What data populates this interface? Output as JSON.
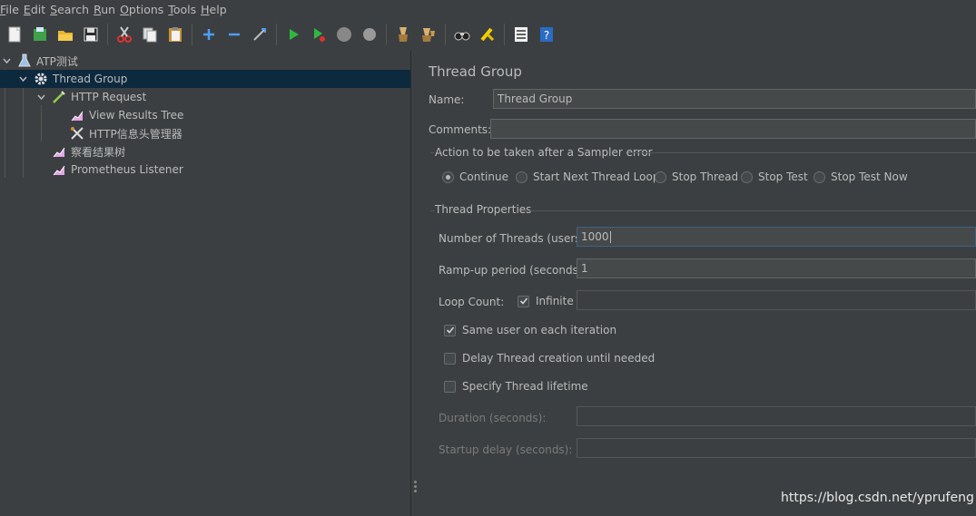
{
  "menu": [
    {
      "mnemonic": "F",
      "rest": "ile"
    },
    {
      "mnemonic": "E",
      "rest": "dit"
    },
    {
      "mnemonic": "S",
      "rest": "earch"
    },
    {
      "mnemonic": "R",
      "rest": "un"
    },
    {
      "mnemonic": "O",
      "rest": "ptions"
    },
    {
      "mnemonic": "T",
      "rest": "ools"
    },
    {
      "mnemonic": "H",
      "rest": "elp"
    }
  ],
  "toolbar_icons": [
    "new-icon",
    "templates-icon",
    "open-icon",
    "save-icon",
    "cut-icon",
    "copy-icon",
    "paste-icon",
    "expand-icon",
    "collapse-icon",
    "toggle-icon",
    "start-icon",
    "start-no-pause-icon",
    "stop-icon",
    "shutdown-icon",
    "clear-icon",
    "clear-all-icon",
    "search-icon",
    "reset-search-icon",
    "function-helper-icon",
    "help-icon"
  ],
  "tree": {
    "test_plan": "ATP测试",
    "thread_group": "Thread Group",
    "http_request": "HTTP Request",
    "view_results_tree": "View Results Tree",
    "header_manager": "HTTP信息头管理器",
    "results_tree_cn": "察看结果树",
    "prometheus": "Prometheus Listener"
  },
  "panel": {
    "title": "Thread Group",
    "name_label": "Name:",
    "name_value": "Thread Group",
    "comments_label": "Comments:",
    "comments_value": "",
    "error_section": "Action to be taken after a Sampler error",
    "error_options": [
      "Continue",
      "Start Next Thread Loop",
      "Stop Thread",
      "Stop Test",
      "Stop Test Now"
    ],
    "error_selected": "Continue",
    "thread_props": "Thread Properties",
    "threads_label": "Number of Threads (users):",
    "threads_value": "1000",
    "rampup_label": "Ramp-up period (seconds):",
    "rampup_value": "1",
    "loop_label": "Loop Count:",
    "infinite_label": "Infinite",
    "infinite_checked": true,
    "loop_value": "",
    "same_user_label": "Same user on each iteration",
    "same_user_checked": true,
    "delay_label": "Delay Thread creation until needed",
    "delay_checked": false,
    "lifetime_label": "Specify Thread lifetime",
    "lifetime_checked": false,
    "duration_label": "Duration (seconds):",
    "duration_value": "",
    "startup_label": "Startup delay (seconds):",
    "startup_value": ""
  },
  "watermark": "https://blog.csdn.net/yprufeng",
  "colors": {
    "background": "#3c3f41",
    "selection": "#0d293e",
    "text": "#bbbbbb",
    "field": "#45494a"
  }
}
